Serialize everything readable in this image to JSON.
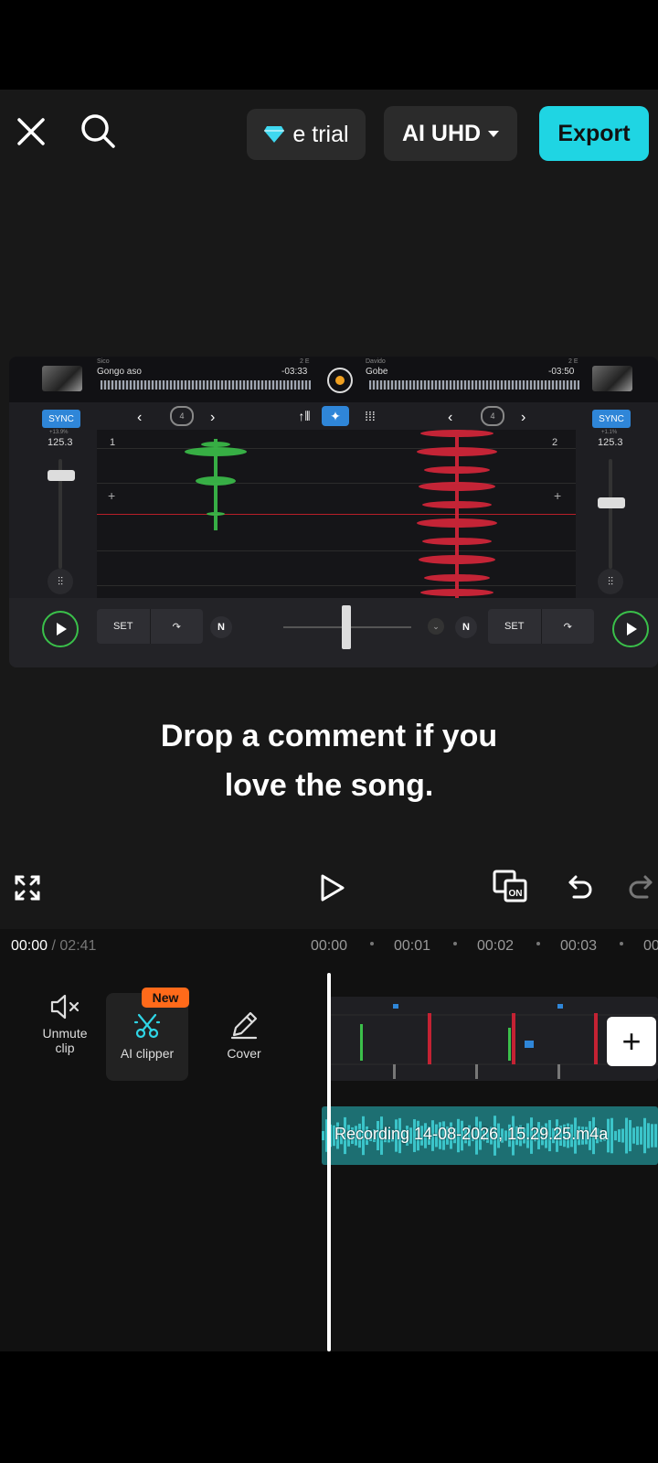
{
  "topbar": {
    "trial_label": "e trial",
    "quality_label": "AI UHD",
    "export_label": "Export"
  },
  "dj": {
    "left_deck": {
      "artist": "Sico",
      "title": "Gongo aso",
      "time": "-03:33",
      "key": "2 E",
      "bpm": "125.3",
      "pitch": "+13.9%",
      "deck_number": "1"
    },
    "right_deck": {
      "artist": "Davido",
      "title": "Gobe",
      "time": "-03:50",
      "key": "2 E",
      "bpm": "125.3",
      "pitch": "+1.1%",
      "deck_number": "2"
    },
    "sync_label": "SYNC",
    "loop_size": "4",
    "set_label": "SET",
    "n_label": "N"
  },
  "caption": {
    "line1": "Drop a comment if you",
    "line2": "love the song."
  },
  "timeline": {
    "current_time": "00:00",
    "total_time": "/ 02:41",
    "ruler": [
      "00:00",
      "00:01",
      "00:02",
      "00:03",
      "00"
    ],
    "tools": [
      {
        "label_line1": "Unmute",
        "label_line2": "clip"
      },
      {
        "label_line1": "AI clipper",
        "label_line2": ""
      },
      {
        "label_line1": "Cover",
        "label_line2": ""
      }
    ],
    "new_badge": "New",
    "audio_clip_name": "Recording 14-08-2026, 15.29.25.m4a"
  },
  "colors": {
    "accent": "#1fd5e3",
    "badge": "#ff6a1a",
    "audio_track": "#1d6f72",
    "sync": "#2f86d8",
    "play_ring": "#3ac04a"
  }
}
